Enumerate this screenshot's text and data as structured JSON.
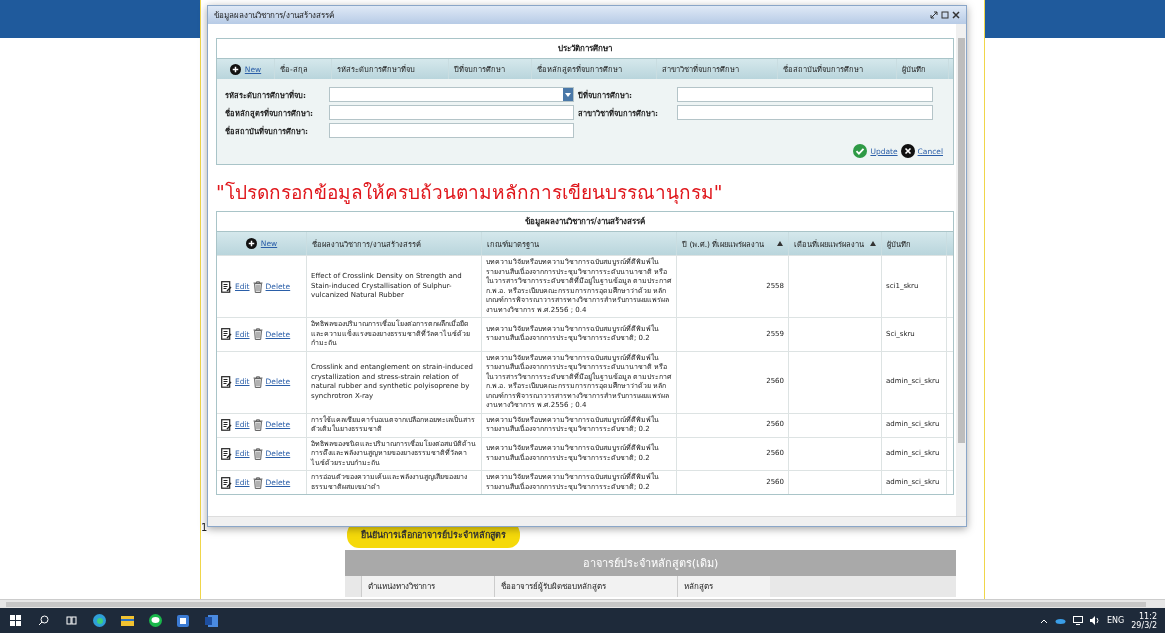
{
  "dialog": {
    "title": "ข้อมูลผลงานวิชาการ/งานสร้างสรรค์"
  },
  "education": {
    "title": "ประวัติการศึกษา",
    "new_label": "New",
    "columns": [
      "ชื่อ-สกุล",
      "รหัสระดับการศึกษาที่จบ",
      "ปีที่จบการศึกษา",
      "ชื่อหลักสูตรที่จบการศึกษา",
      "สาขาวิชาที่จบการศึกษา",
      "ชื่อสถาบันที่จบการศึกษา",
      "ผู้บันทึก"
    ],
    "fields": [
      {
        "label": "รหัสระดับการศึกษาที่จบ:",
        "kind": "select"
      },
      {
        "label": "ปีที่จบการศึกษา:",
        "kind": "text"
      },
      {
        "label": "ชื่อหลักสูตรที่จบการศึกษา:",
        "kind": "text"
      },
      {
        "label": "สาขาวิชาที่จบการศึกษา:",
        "kind": "text"
      },
      {
        "label": "ชื่อสถาบันที่จบการศึกษา:",
        "kind": "text"
      }
    ],
    "update_label": "Update",
    "cancel_label": "Cancel"
  },
  "notice": "\"โปรดกรอกข้อมูลให้ครบถ้วนตามหลักการเขียนบรรณานุกรม\"",
  "works": {
    "title": "ข้อมูลผลงานวิชาการ/งานสร้างสรรค์",
    "new_label": "New",
    "columns": [
      {
        "label": "ชื่อผลงานวิชาการ/งานสร้างสรรค์",
        "sortable": false
      },
      {
        "label": "เกณฑ์มาตรฐาน",
        "sortable": false
      },
      {
        "label": "ปี (พ.ศ.) ที่เผยแพร่ผลงาน",
        "sortable": true
      },
      {
        "label": "เดือนที่เผยแพร่ผลงาน",
        "sortable": true
      },
      {
        "label": "ผู้บันทึก",
        "sortable": false
      }
    ],
    "rows": [
      {
        "edit": "Edit",
        "delete": "Delete",
        "title": "Effect of Crosslink Density on Strength and Stain-induced Crystallisation of Sulphur-vulcanized Natural Rubber",
        "criteria": "บทความวิจัยหรือบทความวิชาการฉบับสมบูรณ์ที่ตีพิมพ์ในรายงานสืบเนื่องจากการประชุมวิชาการระดับนานาชาติ หรือในวารสารวิชาการระดับชาติที่มีอยู่ในฐานข้อมูล ตามประกาศ ก.พ.อ. หรือระเบียบคณะกรรมการการอุดมศึกษาว่าด้วย หลักเกณฑ์การพิจารณาวารสารทางวิชาการสำหรับการเผยแพร่ผลงานทางวิชาการ พ.ศ.2556 ; 0.4",
        "year": "2558",
        "recorder": "sci1_skru"
      },
      {
        "edit": "Edit",
        "delete": "Delete",
        "title": "อิทธิพลของปริมาณการเชื่อมโยงต่อการตกผลึกเมื่อยืดและความแข็งแรงของยางธรรมชาติที่วัลคาไนซ์ด้วยกำมะถัน",
        "criteria": "บทความวิจัยหรือบทความวิชาการฉบับสมบูรณ์ที่ตีพิมพ์ในรายงานสืบเนื่องจากการประชุมวิชาการระดับชาติ; 0.2",
        "year": "2559",
        "recorder": "Sci_skru"
      },
      {
        "edit": "Edit",
        "delete": "Delete",
        "title": "Crosslink and entanglement on strain-induced crystallization and stress-strain relation of natural rubber and synthetic polyisoprene by synchrotron X-ray",
        "criteria": "บทความวิจัยหรือบทความวิชาการฉบับสมบูรณ์ที่ตีพิมพ์ในรายงานสืบเนื่องจากการประชุมวิชาการระดับนานาชาติ หรือในวารสารวิชาการระดับชาติที่มีอยู่ในฐานข้อมูล ตามประกาศ ก.พ.อ. หรือระเบียบคณะกรรมการการอุดมศึกษาว่าด้วย หลักเกณฑ์การพิจารณาวารสารทางวิชาการสำหรับการเผยแพร่ผลงานทางวิชาการ พ.ศ.2556 ; 0.4",
        "year": "2560",
        "recorder": "admin_sci_skru"
      },
      {
        "edit": "Edit",
        "delete": "Delete",
        "title": "การใช้แคลเซียมคาร์บอเนตจากเปลือกหอยทะเลเป็นสารตัวเติมในยางธรรมชาติ",
        "criteria": "บทความวิจัยหรือบทความวิชาการฉบับสมบูรณ์ที่ตีพิมพ์ในรายงานสืบเนื่องจากการประชุมวิชาการระดับชาติ; 0.2",
        "year": "2560",
        "recorder": "admin_sci_skru"
      },
      {
        "edit": "Edit",
        "delete": "Delete",
        "title": "อิทธิพลของชนิดและปริมาณการเชื่อมโยงต่อสมบัติด้านการดึงและพลังงานสูญหายของยางธรรมชาติที่วัลคาไนซ์ด้วยระบบกำมะถัน",
        "criteria": "บทความวิจัยหรือบทความวิชาการฉบับสมบูรณ์ที่ตีพิมพ์ในรายงานสืบเนื่องจากการประชุมวิชาการระดับชาติ; 0.2",
        "year": "2560",
        "recorder": "admin_sci_skru"
      },
      {
        "edit": "Edit",
        "delete": "Delete",
        "title": "การอ่อนตัวของความเค้นและพลังงานสูญเสียของยางธรรมชาติผสมเขม่าดำ",
        "criteria": "บทความวิจัยหรือบทความวิชาการฉบับสมบูรณ์ที่ตีพิมพ์ในรายงานสืบเนื่องจากการประชุมวิชาการระดับชาติ; 0.2",
        "year": "2560",
        "recorder": "admin_sci_skru"
      }
    ]
  },
  "background": {
    "page_number": "1",
    "confirm_button": "ยืนยันการเลือกอาจารย์ประจำหลักสูตร",
    "lecturers": {
      "title": "อาจารย์ประจำหลักสูตร(เดิม)",
      "columns": [
        "ตำแหน่งทางวิชาการ",
        "ชื่ออาจารย์ผู้รับผิดชอบหลักสูตร",
        "หลักสูตร"
      ]
    }
  },
  "taskbar": {
    "language": "ENG",
    "time": "11:2",
    "date": "29/3/2"
  }
}
